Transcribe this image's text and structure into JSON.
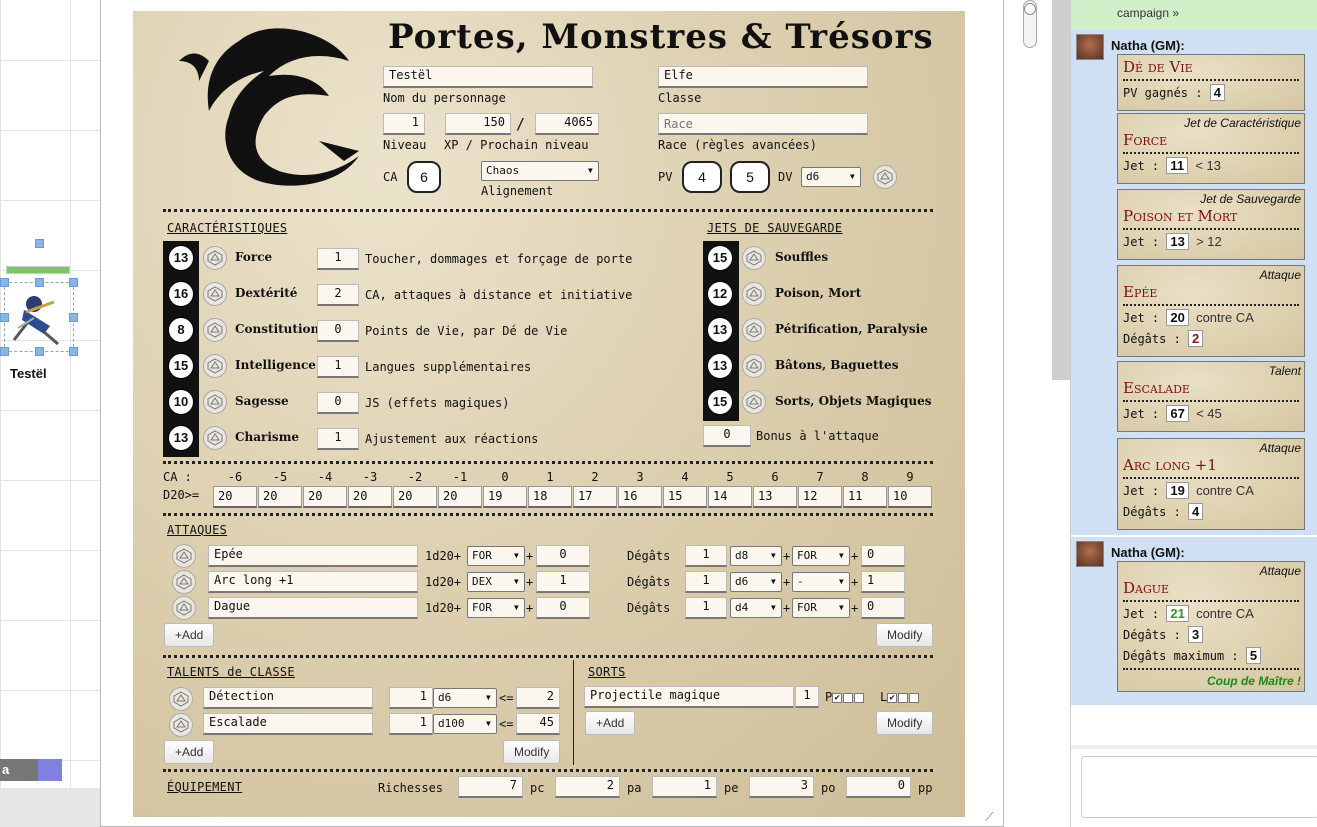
{
  "stage": {
    "token_name": "Testël",
    "chip_label": "a"
  },
  "sheet": {
    "title": "Portes, Monstres & Trésors",
    "character_name": "Testël",
    "character_name_label": "Nom du personnage",
    "class": "Elfe",
    "class_label": "Classe",
    "level": "1",
    "xp": "150",
    "xp_slash": "/",
    "next_level": "4065",
    "level_label": "Niveau",
    "xp_label": "XP / Prochain niveau",
    "race_placeholder": "Race",
    "race_label": "Race (règles avancées)",
    "ca_label": "CA",
    "ca": "6",
    "alignment": "Chaos",
    "alignment_label": "Alignement",
    "pv_label": "PV",
    "pv_current": "4",
    "pv_max": "5",
    "dv_label": "DV",
    "dv": "d6",
    "characteristics_header": "CARACTÉRISTIQUES",
    "saves_header": "JETS DE SAUVEGARDE",
    "attributes": [
      {
        "score": "13",
        "name": "Force",
        "mod": "1",
        "desc": "Toucher, dommages et forçage de porte"
      },
      {
        "score": "16",
        "name": "Dextérité",
        "mod": "2",
        "desc": "CA, attaques à distance et initiative"
      },
      {
        "score": "8",
        "name": "Constitution",
        "mod": "0",
        "desc": "Points de Vie, par Dé de Vie"
      },
      {
        "score": "15",
        "name": "Intelligence",
        "mod": "1",
        "desc": "Langues supplémentaires"
      },
      {
        "score": "10",
        "name": "Sagesse",
        "mod": "0",
        "desc": "JS (effets magiques)"
      },
      {
        "score": "13",
        "name": "Charisme",
        "mod": "1",
        "desc": "Ajustement aux réactions"
      }
    ],
    "saves": [
      {
        "score": "15",
        "name": "Souffles"
      },
      {
        "score": "12",
        "name": "Poison, Mort"
      },
      {
        "score": "13",
        "name": "Pétrification, Paralysie"
      },
      {
        "score": "13",
        "name": "Bâtons, Baguettes"
      },
      {
        "score": "15",
        "name": "Sorts, Objets Magiques"
      }
    ],
    "attack_bonus": "0",
    "attack_bonus_label": "Bonus à l'attaque",
    "ca_table_label": "CA :",
    "d20_label": "D20>=",
    "ca_headers": [
      "-6",
      "-5",
      "-4",
      "-3",
      "-2",
      "-1",
      "0",
      "1",
      "2",
      "3",
      "4",
      "5",
      "6",
      "7",
      "8",
      "9"
    ],
    "d20_values": [
      "20",
      "20",
      "20",
      "20",
      "20",
      "20",
      "19",
      "18",
      "17",
      "16",
      "15",
      "14",
      "13",
      "12",
      "11",
      "10"
    ],
    "attacks_header": "ATTAQUES",
    "attack_dice_label": "1d20+",
    "damage_label": "Dégâts",
    "attacks": [
      {
        "name": "Epée",
        "stat": "FOR",
        "bonus": "0",
        "dmg_count": "1",
        "dmg_die": "d8",
        "dmg_stat": "FOR",
        "dmg_bonus": "0"
      },
      {
        "name": "Arc long +1",
        "stat": "DEX",
        "bonus": "1",
        "dmg_count": "1",
        "dmg_die": "d6",
        "dmg_stat": "-",
        "dmg_bonus": "1"
      },
      {
        "name": "Dague",
        "stat": "FOR",
        "bonus": "0",
        "dmg_count": "1",
        "dmg_die": "d4",
        "dmg_stat": "FOR",
        "dmg_bonus": "0"
      }
    ],
    "add_label": "+Add",
    "modify_label": "Modify",
    "talents_header": "TALENTS de CLASSE",
    "talents": [
      {
        "name": "Détection",
        "count": "1",
        "die": "d6",
        "target": "2"
      },
      {
        "name": "Escalade",
        "count": "1",
        "die": "d100",
        "target": "45"
      }
    ],
    "talent_le": "<=",
    "spells_header": "SORTS",
    "spells": [
      {
        "name": "Projectile magique",
        "level": "1",
        "p_label": "P",
        "l_label": "L"
      }
    ],
    "equipment_header": "ÉQUIPEMENT",
    "wealth_label": "Richesses",
    "coins": [
      {
        "value": "7",
        "unit": "pc"
      },
      {
        "value": "2",
        "unit": "pa"
      },
      {
        "value": "1",
        "unit": "pe"
      },
      {
        "value": "3",
        "unit": "po"
      },
      {
        "value": "0",
        "unit": "pp"
      }
    ],
    "plus": "+"
  },
  "chat": {
    "top_text": "campaign »",
    "sender": "Natha (GM):",
    "cards": [
      {
        "title": "Dé de Vie",
        "subtitle": "",
        "rows": [
          {
            "label": "PV gagnés :",
            "value": "4",
            "tail": ""
          }
        ]
      },
      {
        "title": "Force",
        "subtitle": "Jet de Caractéristique",
        "rows": [
          {
            "label": "Jet :",
            "value": "11",
            "tail": "< 13"
          }
        ]
      },
      {
        "title": "Poison et Mort",
        "subtitle": "Jet de Sauvegarde",
        "rows": [
          {
            "label": "Jet :",
            "value": "13",
            "tail": "> 12"
          }
        ]
      },
      {
        "title": "Epée",
        "subtitle": "Attaque",
        "rows": [
          {
            "label": "Jet :",
            "value": "20",
            "tail": "contre CA"
          },
          {
            "label": "Dégâts :",
            "value": "2",
            "tail": ""
          }
        ]
      },
      {
        "title": "Escalade",
        "subtitle": "Talent",
        "rows": [
          {
            "label": "Jet :",
            "value": "67",
            "tail": "< 45"
          }
        ]
      },
      {
        "title": "Arc long +1",
        "subtitle": "Attaque",
        "rows": [
          {
            "label": "Jet :",
            "value": "19",
            "tail": "contre CA"
          },
          {
            "label": "Dégâts :",
            "value": "4",
            "tail": ""
          }
        ]
      },
      {
        "title": "Dague",
        "subtitle": "Attaque",
        "rows": [
          {
            "label": "Jet :",
            "value": "21",
            "tail": "contre CA"
          },
          {
            "label": "Dégâts :",
            "value": "3",
            "tail": ""
          },
          {
            "label": "Dégâts maximum :",
            "value": "5",
            "tail": ""
          }
        ],
        "footer": "Coup de Maître !"
      }
    ]
  }
}
